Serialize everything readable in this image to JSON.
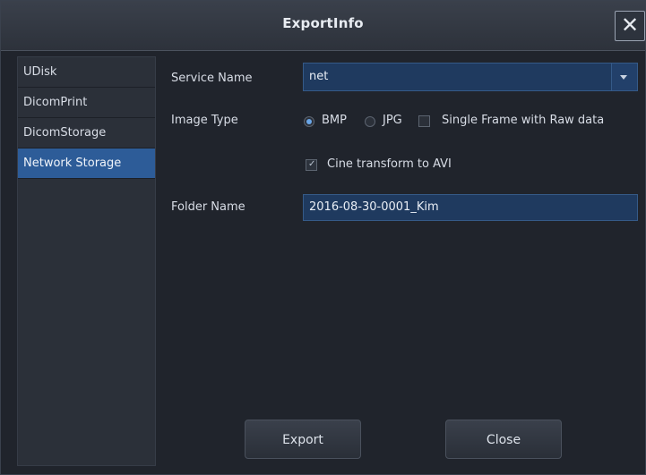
{
  "window": {
    "title": "ExportInfo",
    "close_glyph": "✕",
    "close_icon": "close-icon"
  },
  "sidebar": {
    "items": [
      {
        "label": "UDisk"
      },
      {
        "label": "DicomPrint"
      },
      {
        "label": "DicomStorage"
      },
      {
        "label": "Network Storage",
        "active": true
      }
    ]
  },
  "form": {
    "service_name_label": "Service Name",
    "service_name_value": "net",
    "image_type_label": "Image Type",
    "image_type_options": [
      {
        "label": "BMP",
        "checked": true
      },
      {
        "label": "JPG",
        "checked": false
      }
    ],
    "single_frame_label": "Single Frame with Raw data",
    "single_frame_checked": false,
    "cine_label": "Cine transform to AVI",
    "cine_checked": true,
    "cine_tick": "✓",
    "folder_name_label": "Folder Name",
    "folder_name_value": "2016-08-30-0001_Kim"
  },
  "buttons": {
    "export_label": "Export",
    "close_label": "Close"
  },
  "colors": {
    "accent": "#2d5c98",
    "field_bg": "#1f3a5f",
    "background": "#20242c",
    "sidebar_bg": "#2b3039"
  }
}
